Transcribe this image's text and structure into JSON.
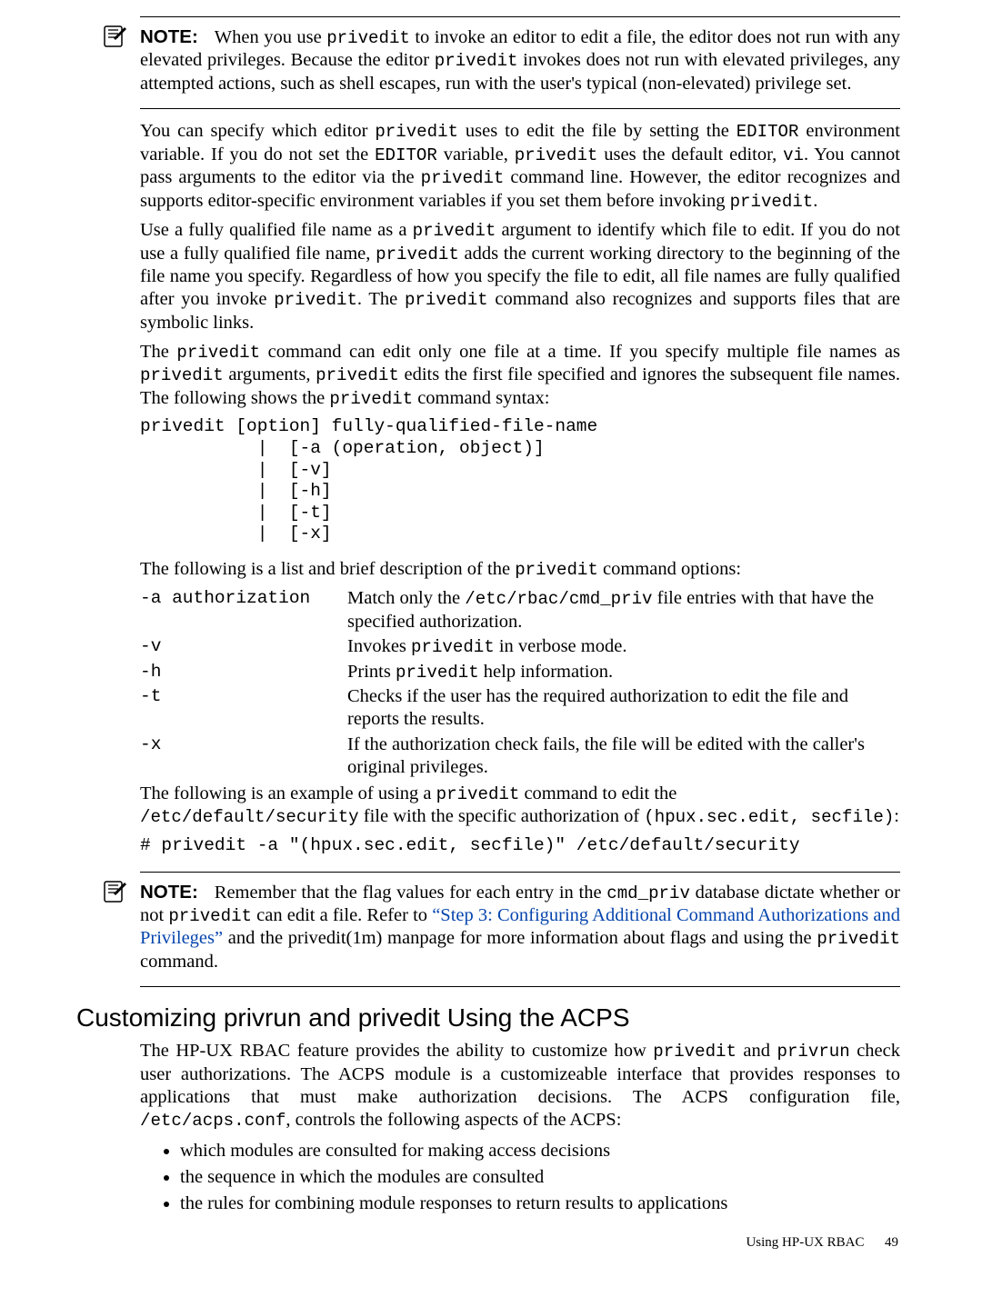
{
  "note1": {
    "label": "NOTE:",
    "body": "When you use <span class=\"mono\">privedit</span> to invoke an editor to edit a file, the editor does not run with any elevated privileges. Because the editor <span class=\"mono\">privedit</span> invokes does not run with elevated privileges, any attempted actions, such as shell escapes, run with the user's typical (non-elevated) privilege set."
  },
  "para1": "You can specify which editor <span class=\"mono\">privedit</span> uses to edit the file by setting the <span class=\"mono\">EDITOR</span> environment variable. If you do not set the <span class=\"mono\">EDITOR</span> variable, <span class=\"mono\">privedit</span> uses the default editor, <span class=\"mono\">vi</span>. You cannot pass arguments to the editor via the <span class=\"mono\">privedit</span> command line. However, the editor recognizes and supports editor-specific environment variables if you set them before invoking <span class=\"mono\">privedit</span>.",
  "para2": "Use a fully qualified file name as a <span class=\"mono\">privedit</span> argument to identify which file to edit. If you do not use a fully qualified file name, <span class=\"mono\">privedit</span> adds the current working directory to the beginning of the file name you specify. Regardless of how you specify the file to edit, all file names are fully qualified after you invoke <span class=\"mono\">privedit</span>. The <span class=\"mono\">privedit</span> command also recognizes and supports files that are symbolic links.",
  "para3": "The <span class=\"mono\">privedit</span> command can edit only one file at a time. If you specify multiple file names as <span class=\"mono\">privedit</span> arguments, <span class=\"mono\">privedit</span> edits the first file specified and ignores the subsequent file names. The following shows the <span class=\"mono\">privedit</span> command syntax:",
  "syntax": "privedit [option] fully-qualified-file-name\n           |  [-a (operation, object)]\n           |  [-v]\n           |  [-h]\n           |  [-t]\n           |  [-x]",
  "para4": "The following is a list and brief description of the <span class=\"mono\">privedit</span> command options:",
  "options": [
    {
      "key": "-a authorization",
      "desc": "Match only the <span class=\"mono\">/etc/rbac/cmd_priv</span> file entries with that have the specified authorization."
    },
    {
      "key": "-v",
      "desc": "Invokes <span class=\"mono\">privedit</span> in verbose mode."
    },
    {
      "key": "-h",
      "desc": "Prints <span class=\"mono\">privedit</span> help information."
    },
    {
      "key": "-t",
      "desc": "Checks if the user has the required authorization to edit the file and reports the results."
    },
    {
      "key": "-x",
      "desc": "If the authorization check fails, the file will be edited with the caller's original privileges."
    }
  ],
  "para5": "The following is an example of using a <span class=\"mono\">privedit</span> command to edit the",
  "para6": "<span class=\"mono\">/etc/default/security</span> file with the specific authorization of <span class=\"mono\">(hpux.sec.edit, secfile)</span>:",
  "cmdline": "# privedit -a \"(hpux.sec.edit, secfile)\" /etc/default/security",
  "note2": {
    "label": "NOTE:",
    "body": "Remember that the flag values for each entry in the <span class=\"mono\">cmd_priv</span> database dictate whether or not <span class=\"mono\">privedit</span> can edit a file. Refer to <a class=\"link\" data-interactable=\"true\" data-name=\"link-step3\">“Step 3: Configuring Additional Command Authorizations and Privileges”</a> and the privedit(1m) manpage for more information about flags and using the <span class=\"mono\">privedit</span> command."
  },
  "heading": "Customizing privrun and privedit Using the ACPS",
  "para7": "The HP-UX RBAC feature provides the ability to customize how <span class=\"mono\">privedit</span> and <span class=\"mono\">privrun</span> check user authorizations. The ACPS module is a customizeable interface that provides responses to applications that must make authorization decisions. The ACPS configuration file, <span class=\"mono\">/etc/acps.conf</span>, controls the following aspects of the ACPS:",
  "bullets": [
    "which modules are consulted for making access decisions",
    "the sequence in which the modules are consulted",
    "the rules for combining module responses to return results to applications"
  ],
  "footer": "Using HP-UX RBAC  49"
}
